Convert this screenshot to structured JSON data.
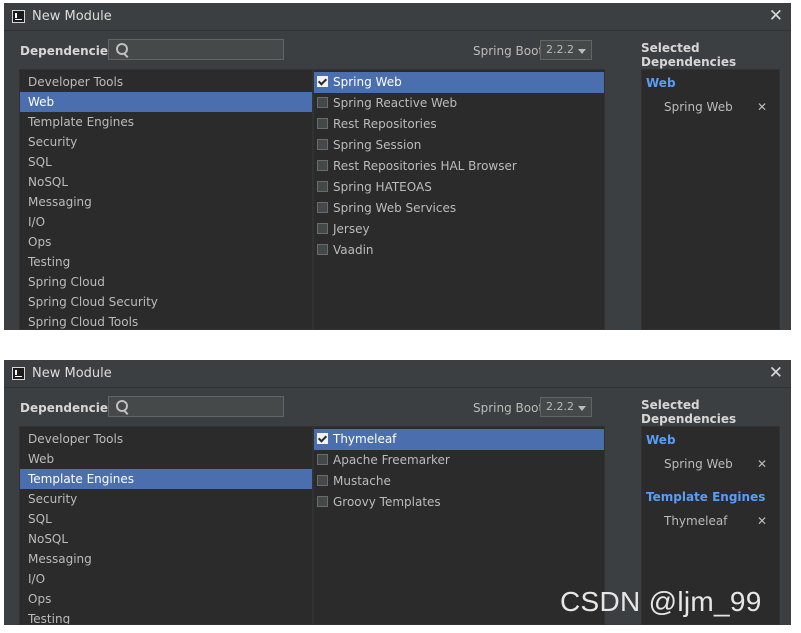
{
  "panels": [
    {
      "title": "New Module",
      "dependencies_label": "Dependencies",
      "search_value": "",
      "spring_boot_label": "Spring Boot",
      "spring_boot_version": "2.2.2",
      "selected_header": "Selected Dependencies",
      "categories": [
        "Developer Tools",
        "Web",
        "Template Engines",
        "Security",
        "SQL",
        "NoSQL",
        "Messaging",
        "I/O",
        "Ops",
        "Testing",
        "Spring Cloud",
        "Spring Cloud Security",
        "Spring Cloud Tools"
      ],
      "active_category": "Web",
      "dependencies": [
        {
          "label": "Spring Web",
          "checked": true
        },
        {
          "label": "Spring Reactive Web",
          "checked": false
        },
        {
          "label": "Rest Repositories",
          "checked": false
        },
        {
          "label": "Spring Session",
          "checked": false
        },
        {
          "label": "Rest Repositories HAL Browser",
          "checked": false
        },
        {
          "label": "Spring HATEOAS",
          "checked": false
        },
        {
          "label": "Spring Web Services",
          "checked": false
        },
        {
          "label": "Jersey",
          "checked": false
        },
        {
          "label": "Vaadin",
          "checked": false
        }
      ],
      "selected": [
        {
          "group": "Web",
          "items": [
            "Spring Web"
          ]
        }
      ],
      "remove_glyph": "✕"
    },
    {
      "title": "New Module",
      "dependencies_label": "Dependencies",
      "search_value": "",
      "spring_boot_label": "Spring Boot",
      "spring_boot_version": "2.2.2",
      "selected_header": "Selected Dependencies",
      "categories": [
        "Developer Tools",
        "Web",
        "Template Engines",
        "Security",
        "SQL",
        "NoSQL",
        "Messaging",
        "I/O",
        "Ops",
        "Testing"
      ],
      "active_category": "Template Engines",
      "dependencies": [
        {
          "label": "Thymeleaf",
          "checked": true
        },
        {
          "label": "Apache Freemarker",
          "checked": false
        },
        {
          "label": "Mustache",
          "checked": false
        },
        {
          "label": "Groovy Templates",
          "checked": false
        }
      ],
      "selected": [
        {
          "group": "Web",
          "items": [
            "Spring Web"
          ]
        },
        {
          "group": "Template Engines",
          "items": [
            "Thymeleaf"
          ]
        }
      ],
      "remove_glyph": "✕"
    }
  ],
  "icons": {
    "app": "intellij-app-icon",
    "search": "search-icon",
    "close": "close-icon",
    "caret": "chevron-down-icon"
  },
  "colors": {
    "accent": "#4b6eaf",
    "group_link": "#589df6",
    "background": "#3c3f41",
    "list_bg": "#2b2b2b"
  },
  "watermark": "CSDN @ljm_99"
}
